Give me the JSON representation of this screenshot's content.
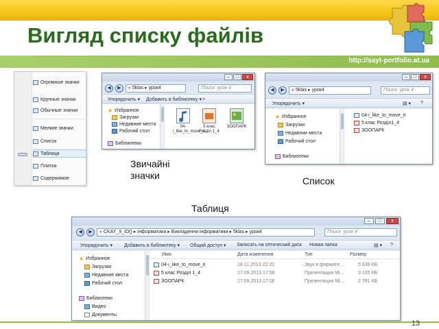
{
  "slide": {
    "title": "Вигляд списку файлів",
    "url": "http://sayt-portfolio.at.ua",
    "page_number": "13",
    "colors": {
      "title": "#2c6b1e",
      "top_band": "#f6c61a",
      "green_band": "#8fbd4a"
    }
  },
  "captions": {
    "regular_icons": "Звичайні\nзначки",
    "list": "Список",
    "table": "Таблиця"
  },
  "view_menu": {
    "items": [
      {
        "label": "Огромные значки",
        "icon": "huge-icons-icon"
      },
      {
        "label": "Крупные значки",
        "icon": "large-icons-icon"
      },
      {
        "label": "Обычные значки",
        "icon": "medium-icons-icon"
      },
      {
        "label": "Мелкие значки",
        "icon": "small-icons-icon"
      },
      {
        "label": "Список",
        "icon": "list-icon"
      },
      {
        "label": "Таблица",
        "icon": "details-icon",
        "selected": true
      },
      {
        "label": "Плитка",
        "icon": "tiles-icon"
      },
      {
        "label": "Содержимое",
        "icon": "content-icon"
      }
    ]
  },
  "window_icons": {
    "address": "« 5klas ▸ урок4",
    "search_placeholder": "Поиск: урок 4",
    "toolbar": [
      "Упорядочить ▾",
      "Добавить в библиотеку ▾",
      "»"
    ],
    "nav": [
      {
        "label": "Избранное",
        "icon": "star-icon"
      },
      {
        "label": "Загрузки",
        "icon": "folder-icon"
      },
      {
        "label": "Недавние места",
        "icon": "recent-places-icon"
      },
      {
        "label": "Рабочий стол",
        "icon": "desktop-icon"
      },
      {
        "label": "Библиотеки",
        "icon": "library-icon"
      }
    ],
    "files": [
      {
        "name": "04-i_like_to_move_it",
        "icon": "music-icon"
      },
      {
        "name": "5 клас Розділ 1_4",
        "icon": "presentation-icon"
      },
      {
        "name": "ЗООПАРК",
        "icon": "image-icon"
      }
    ]
  },
  "window_list": {
    "address": "« 5klas ▸ урок4",
    "search_placeholder": "Поиск: урок 4",
    "toolbar": [
      "Упорядочить ▾"
    ],
    "nav": [
      {
        "label": "Избранное",
        "icon": "star-icon"
      },
      {
        "label": "Загрузки",
        "icon": "folder-icon"
      },
      {
        "label": "Недавние места",
        "icon": "recent-places-icon"
      },
      {
        "label": "Рабочий стол",
        "icon": "desktop-icon"
      },
      {
        "label": "Библиотеки",
        "icon": "library-icon"
      }
    ],
    "files": [
      {
        "name": "04-i_like_to_move_it",
        "icon": "music-icon"
      },
      {
        "name": "5 клас Розділ1_4",
        "icon": "pdf-icon"
      },
      {
        "name": "ЗООПАРК",
        "icon": "pdf-icon"
      }
    ]
  },
  "window_table": {
    "address": "« CKAY_9_ID() ▸ Інформатика ▸ Викладення інформатики ▸ 5klas ▸ урок4",
    "search_placeholder": "Поиск: урок 4",
    "toolbar": [
      "Упорядочить ▾",
      "Добавить в библиотеку ▾",
      "Общий доступ ▾",
      "Записать на оптический диск",
      "Новая папка"
    ],
    "nav": [
      {
        "label": "Избранное",
        "icon": "star-icon"
      },
      {
        "label": "Загрузки",
        "icon": "folder-icon"
      },
      {
        "label": "Недавние места",
        "icon": "recent-places-icon"
      },
      {
        "label": "Рабочий стол",
        "icon": "desktop-icon"
      },
      {
        "label": "Библиотеки",
        "icon": "library-icon"
      },
      {
        "label": "Видео",
        "icon": "video-icon"
      },
      {
        "label": "Документы",
        "icon": "documents-icon"
      }
    ],
    "columns": [
      "Имя",
      "Дата изменения",
      "Тип",
      "Размер"
    ],
    "rows": [
      {
        "name": "04-i_like_to_move_it",
        "date": "18.11.2013 22:20",
        "type": "Звук в формате ...",
        "size": "5 638 КБ",
        "icon": "music-icon"
      },
      {
        "name": "5 клас Розділ 1_4",
        "date": "17.09.2013 17:58",
        "type": "Презентация Mi...",
        "size": "3 105 КБ",
        "icon": "pdf-icon"
      },
      {
        "name": "ЗООПАРК",
        "date": "17.09.2013 17:06",
        "type": "Презентация Mi...",
        "size": "2 781 КБ",
        "icon": "pdf-icon"
      }
    ]
  }
}
